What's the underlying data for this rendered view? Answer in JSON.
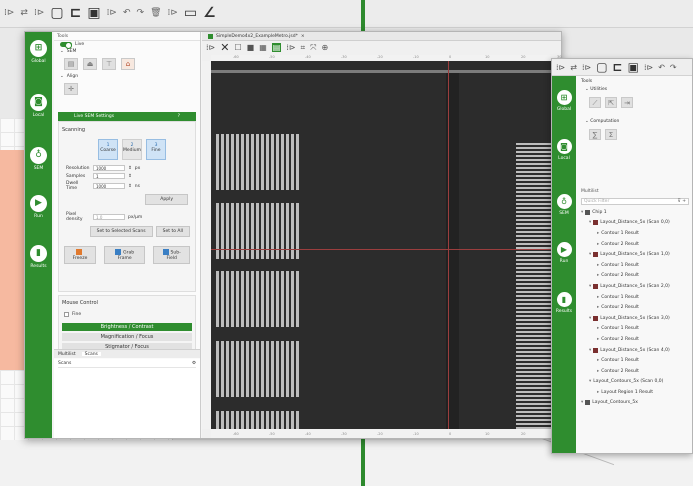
{
  "bg_toolbar": {
    "icons": [
      "dock-icon",
      "swap-icon",
      "separator",
      "new-file-icon",
      "open-folder-icon",
      "save-icon",
      "separator",
      "undo-icon",
      "redo-icon",
      "delete-icon",
      "separator",
      "rectangle-icon",
      "ruler-icon"
    ]
  },
  "main_window": {
    "nav": [
      {
        "label": "Global",
        "icon": "global-icon"
      },
      {
        "label": "Local",
        "icon": "local-icon"
      },
      {
        "label": "SEM",
        "icon": "sem-icon"
      },
      {
        "label": "Run",
        "icon": "run-icon"
      },
      {
        "label": "Results",
        "icon": "results-icon"
      }
    ],
    "tools": {
      "header": "Tools",
      "live_label": "Live",
      "sem_label": "SEM",
      "align_label": "Align",
      "live_sem_bar": "Live SEM Settings",
      "help": "?",
      "scanning_label": "Scanning",
      "modes": [
        {
          "num": "1",
          "label": "Coarse"
        },
        {
          "num": "2",
          "label": "Medium"
        },
        {
          "num": "3",
          "label": "Fine"
        }
      ],
      "resolution_label": "Resolution",
      "resolution_value": "1000",
      "resolution_unit": "px",
      "samples_label": "Samples",
      "samples_value": "1",
      "dwell_label": "Dwell Time",
      "dwell_value": "1000",
      "dwell_unit": "ns",
      "apply_label": "Apply",
      "pixel_density_label": "Pixel density",
      "pixel_density_value": "1.0",
      "pixel_density_unit": "px/µm",
      "set_selected_label": "Set to Selected Scans",
      "set_all_label": "Set to All",
      "freeze_label": "Freeze",
      "grab_label": "Grab Frame",
      "subfield_label": "Sub-Field",
      "mouse_control_label": "Mouse Control",
      "fine_label": "Fine",
      "brightness_label": "Brightness / Contrast",
      "magnification_label": "Magnification / Focus",
      "stigmator_label": "Stigmator / Focus"
    },
    "subtabs": [
      "Multilist",
      "Scans"
    ],
    "scans_label": "Scans",
    "doc": {
      "tab_title": "SimpleDemo4x2_ExampleMetro.jsd*",
      "ruler_top": [
        "-60",
        "-50",
        "-40",
        "-30",
        "-20",
        "-10",
        "0",
        "10",
        "20",
        "30"
      ],
      "ruler_bottom": [
        "-60",
        "-50",
        "-40",
        "-30",
        "-20",
        "-10",
        "0",
        "10",
        "20",
        "30"
      ]
    }
  },
  "right_window": {
    "nav": [
      "Global",
      "Local",
      "SEM",
      "Run",
      "Results"
    ],
    "tools_header": "Tools",
    "utilities_label": "Utilities",
    "computation_label": "Computation",
    "multilist_label": "Multilist",
    "filter_placeholder": "Quick Filter",
    "tree": [
      {
        "indent": 0,
        "label": "Chip 1",
        "icon": "chip"
      },
      {
        "indent": 1,
        "label": "Layout_Distance_5x (Scan 0,0)",
        "icon": "doc"
      },
      {
        "indent": 2,
        "label": "Contour 1 Result",
        "icon": "none"
      },
      {
        "indent": 2,
        "label": "Contour 2 Result",
        "icon": "none"
      },
      {
        "indent": 1,
        "label": "Layout_Distance_5x (Scan 1,0)",
        "icon": "doc"
      },
      {
        "indent": 2,
        "label": "Contour 1 Result",
        "icon": "none"
      },
      {
        "indent": 2,
        "label": "Contour 2 Result",
        "icon": "none"
      },
      {
        "indent": 1,
        "label": "Layout_Distance_5x (Scan 2,0)",
        "icon": "doc"
      },
      {
        "indent": 2,
        "label": "Contour 1 Result",
        "icon": "none"
      },
      {
        "indent": 2,
        "label": "Contour 2 Result",
        "icon": "none"
      },
      {
        "indent": 1,
        "label": "Layout_Distance_5x (Scan 3,0)",
        "icon": "doc"
      },
      {
        "indent": 2,
        "label": "Contour 1 Result",
        "icon": "none"
      },
      {
        "indent": 2,
        "label": "Contour 2 Result",
        "icon": "none"
      },
      {
        "indent": 1,
        "label": "Layout_Distance_5x (Scan 4,0)",
        "icon": "doc"
      },
      {
        "indent": 2,
        "label": "Contour 1 Result",
        "icon": "none"
      },
      {
        "indent": 2,
        "label": "Contour 2 Result",
        "icon": "none"
      },
      {
        "indent": 1,
        "label": "Layout_Contours_5x (Scan 0,0)",
        "icon": "none"
      },
      {
        "indent": 2,
        "label": "Layout Region 1 Result",
        "icon": "none"
      },
      {
        "indent": 0,
        "label": "Layout_Contours_5x",
        "icon": "camera"
      }
    ]
  },
  "colors": {
    "accent": "#2f8d2f",
    "canvas": "#2c2c2c",
    "stripe": "#bdbdbd",
    "crosshair": "#9b3e3e"
  }
}
